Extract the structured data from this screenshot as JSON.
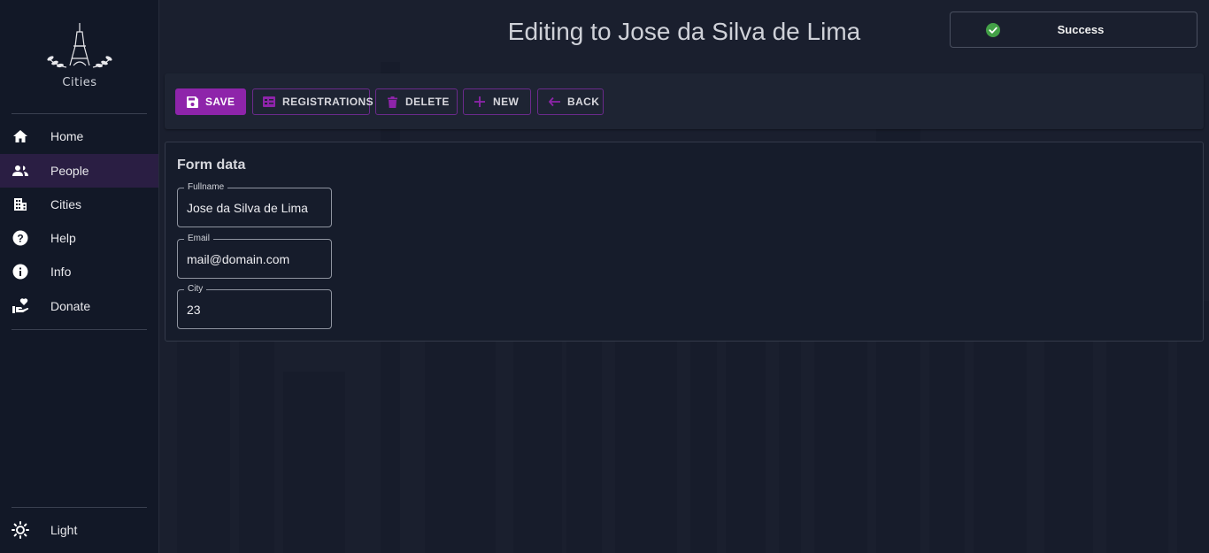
{
  "app": {
    "logo_text": "Cities"
  },
  "sidebar": {
    "items": [
      {
        "label": "Home",
        "icon": "home-icon"
      },
      {
        "label": "People",
        "icon": "people-icon",
        "active": true
      },
      {
        "label": "Cities",
        "icon": "building-icon"
      },
      {
        "label": "Help",
        "icon": "help-icon"
      },
      {
        "label": "Info",
        "icon": "info-icon"
      },
      {
        "label": "Donate",
        "icon": "donate-icon"
      }
    ],
    "theme_toggle": {
      "label": "Light",
      "icon": "sun-icon"
    }
  },
  "header": {
    "title": "Editing to Jose da Silva de Lima"
  },
  "toast": {
    "message": "Success",
    "icon": "check-circle-icon",
    "color": "#43a047"
  },
  "toolbar": {
    "save_label": "SAVE",
    "registrations_label": "REGISTRATIONS",
    "delete_label": "DELETE",
    "new_label": "NEW",
    "back_label": "BACK"
  },
  "form": {
    "title": "Form data",
    "fullname": {
      "label": "Fullname",
      "value": "Jose da Silva de Lima"
    },
    "email": {
      "label": "Email",
      "value": "mail@domain.com"
    },
    "city": {
      "label": "City",
      "value": "23"
    }
  },
  "colors": {
    "accent": "#8e24aa",
    "sidebar_active": "#2a1e43",
    "background": "#1a1f2e",
    "success": "#43a047"
  }
}
